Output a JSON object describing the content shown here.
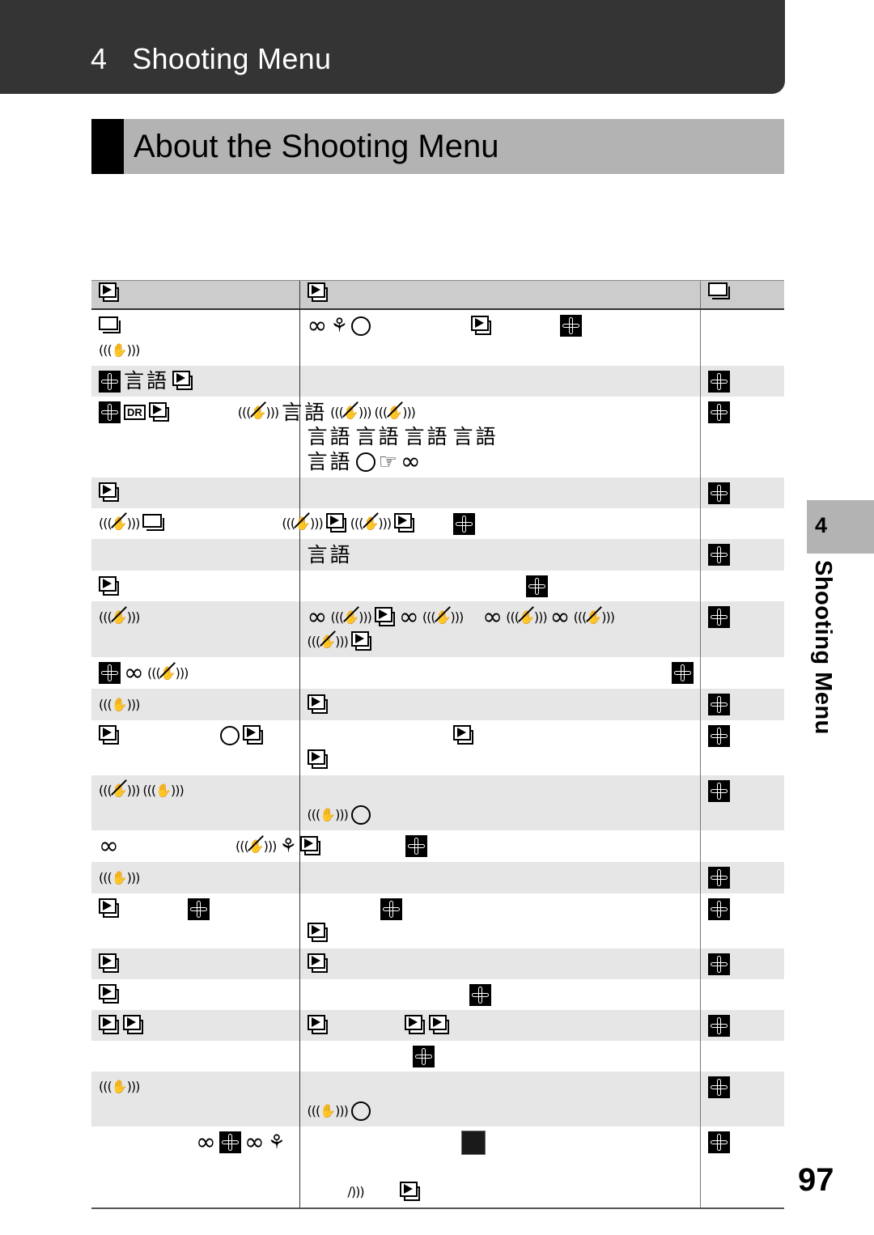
{
  "header": {
    "chapter_number": "4",
    "chapter_title": "Shooting Menu"
  },
  "section": {
    "title": "About the Shooting Menu"
  },
  "side_tab": {
    "number": "4",
    "label": "Shooting Menu"
  },
  "page_number": "97",
  "table": {
    "header": [
      [
        "play"
      ],
      [
        "play"
      ],
      [
        "frames"
      ]
    ],
    "rows": [
      {
        "shade": false,
        "cells": [
          [
            [
              "frames"
            ],
            [
              "stab"
            ]
          ],
          [
            [
              "inf",
              "flower-macro",
              "circle",
              "gap:120",
              "play",
              "gap:80",
              "flower"
            ]
          ],
          []
        ]
      },
      {
        "shade": true,
        "cells": [
          [
            [
              "flower",
              "kanji",
              "play"
            ]
          ],
          [],
          [
            [
              "flower"
            ]
          ]
        ]
      },
      {
        "shade": false,
        "cells": [
          [
            [
              "flower",
              "dr",
              "play",
              "gap:80",
              "stab-off",
              "kanji",
              "stab-off",
              "stab-off"
            ]
          ],
          [
            [
              "gap:0"
            ],
            [
              "kanji",
              "kanji",
              "kanji",
              "kanji"
            ],
            [
              "kanji",
              "circle",
              "point",
              "inf"
            ]
          ],
          [
            [
              "flower"
            ]
          ]
        ]
      },
      {
        "shade": true,
        "cells": [
          [
            [
              "play"
            ]
          ],
          [],
          [
            [
              "flower"
            ]
          ]
        ]
      },
      {
        "shade": false,
        "cells": [
          [
            [
              "stab-off",
              "frames",
              "gap:140",
              "stab-off",
              "play",
              "stab-off",
              "play"
            ]
          ],
          [
            [
              "gap:180",
              "flower"
            ]
          ],
          []
        ]
      },
      {
        "shade": true,
        "cells": [
          [],
          [
            [
              "kanji"
            ]
          ],
          [
            [
              "flower"
            ]
          ]
        ]
      },
      {
        "shade": false,
        "cells": [
          [
            [
              "play"
            ]
          ],
          [
            [
              "gap:270",
              "flower"
            ]
          ],
          []
        ]
      },
      {
        "shade": true,
        "cells": [
          [
            [
              "stab-off"
            ]
          ],
          [
            [
              "inf",
              "stab-off",
              "play",
              "inf",
              "stab-off",
              "gap:20",
              "inf",
              "stab-off",
              "inf",
              "stab-off"
            ],
            [
              "stab-off",
              "play"
            ]
          ],
          [
            [
              "flower"
            ]
          ]
        ]
      },
      {
        "shade": false,
        "cells": [
          [
            [
              "flower",
              "inf",
              "stab-off"
            ]
          ],
          [
            [
              "gap:450",
              "flower"
            ]
          ],
          []
        ]
      },
      {
        "shade": true,
        "cells": [
          [
            [
              "stab"
            ]
          ],
          [
            [
              "play"
            ]
          ],
          [
            [
              "flower"
            ]
          ]
        ]
      },
      {
        "shade": false,
        "cells": [
          [
            [
              "play",
              "gap:120",
              "circle",
              "play"
            ]
          ],
          [
            [
              "gap:180",
              "play"
            ],
            [
              "play"
            ]
          ],
          [
            [
              "flower"
            ]
          ]
        ]
      },
      {
        "shade": true,
        "cells": [
          [
            [
              "stab-off",
              "stab"
            ]
          ],
          [
            [],
            [
              "stab",
              "circle"
            ]
          ],
          [
            [
              "flower"
            ]
          ]
        ]
      },
      {
        "shade": false,
        "cells": [
          [
            [
              "inf",
              "gap:140",
              "stab-off",
              "flower-macro",
              "play",
              "gap:100",
              "flower"
            ]
          ],
          [],
          []
        ]
      },
      {
        "shade": true,
        "cells": [
          [
            [
              "stab"
            ]
          ],
          [],
          [
            [
              "flower"
            ]
          ]
        ]
      },
      {
        "shade": false,
        "cells": [
          [
            [
              "play",
              "gap:80",
              "flower"
            ]
          ],
          [
            [
              "gap:90",
              "flower"
            ],
            [
              "play"
            ]
          ],
          [
            [
              "flower"
            ]
          ]
        ]
      },
      {
        "shade": true,
        "cells": [
          [
            [
              "play"
            ]
          ],
          [
            [
              "play"
            ]
          ],
          [
            [
              "flower"
            ]
          ]
        ]
      },
      {
        "shade": false,
        "cells": [
          [
            [
              "play"
            ]
          ],
          [
            [
              "gap:200",
              "flower"
            ]
          ],
          []
        ]
      },
      {
        "shade": true,
        "cells": [
          [
            [
              "play",
              "play"
            ]
          ],
          [
            [
              "play",
              "gap:90",
              "play",
              "play"
            ]
          ],
          [
            [
              "flower"
            ]
          ]
        ]
      },
      {
        "shade": false,
        "cells": [
          [],
          [
            [
              "gap:130",
              "flower"
            ]
          ],
          []
        ]
      },
      {
        "shade": true,
        "cells": [
          [
            [
              "stab"
            ]
          ],
          [
            [],
            [
              "stab",
              "circle"
            ]
          ],
          [
            [
              "flower"
            ]
          ]
        ]
      },
      {
        "shade": false,
        "cells": [
          [
            [
              "gap:120",
              "inf",
              "flower",
              "inf",
              "flower-macro"
            ]
          ],
          [
            [
              "gap:190",
              "screen"
            ],
            [],
            [
              "gap:50",
              "stab-half",
              "gap:40",
              "play"
            ]
          ],
          [
            [
              "flower"
            ]
          ]
        ]
      }
    ]
  }
}
